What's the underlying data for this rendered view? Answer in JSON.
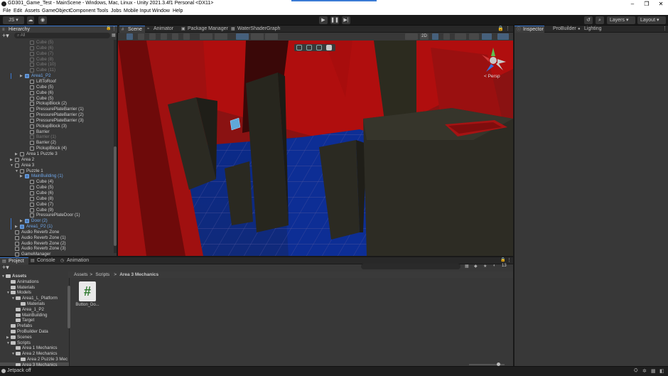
{
  "window": {
    "title": "GD301_Game_Test - MainScene - Windows, Mac, Linux - Unity 2021.3.4f1 Personal <DX11>",
    "controls": [
      "–",
      "❐",
      "✕"
    ]
  },
  "menu": [
    "File",
    "Edit",
    "Assets",
    "GameObject",
    "Component",
    "Tools",
    "Jobs",
    "Mobile Input",
    "Window",
    "Help"
  ],
  "toolbar": {
    "account": "JS ▾",
    "layers": "Layers",
    "layout": "Layout"
  },
  "hierarchy": {
    "tab": "Hierarchy",
    "search_placeholder": "All",
    "rows": [
      {
        "label": "Cube (5)",
        "depth": 6,
        "style": "dim"
      },
      {
        "label": "Cube (6)",
        "depth": 6,
        "style": "dim"
      },
      {
        "label": "Cube (7)",
        "depth": 6,
        "style": "dim"
      },
      {
        "label": "Cube (8)",
        "depth": 6,
        "style": "dim"
      },
      {
        "label": "Cube (10)",
        "depth": 6,
        "style": "dim"
      },
      {
        "label": "Cube (11)",
        "depth": 6,
        "style": "dim"
      },
      {
        "label": "Area1_P2",
        "depth": 5,
        "style": "prefab",
        "arrow": "▶",
        "marker": true
      },
      {
        "label": "LiftToRoof",
        "depth": 6,
        "style": "normal"
      },
      {
        "label": "Cube (5)",
        "depth": 6,
        "style": "normal"
      },
      {
        "label": "Cube (6)",
        "depth": 6,
        "style": "normal"
      },
      {
        "label": "Cube (5)",
        "depth": 6,
        "style": "normal"
      },
      {
        "label": "PickupBlock (2)",
        "depth": 6,
        "style": "normal"
      },
      {
        "label": "PressurePlateBarrier (1)",
        "depth": 6,
        "style": "normal"
      },
      {
        "label": "PressurePlateBarrier (2)",
        "depth": 6,
        "style": "normal"
      },
      {
        "label": "PressurePlateBarrier (3)",
        "depth": 6,
        "style": "normal"
      },
      {
        "label": "PickupBlock (3)",
        "depth": 6,
        "style": "normal"
      },
      {
        "label": "Barrier",
        "depth": 6,
        "style": "normal"
      },
      {
        "label": "Barrier (1)",
        "depth": 6,
        "style": "dim"
      },
      {
        "label": "Barrier (2)",
        "depth": 6,
        "style": "normal"
      },
      {
        "label": "PickupBlock (4)",
        "depth": 6,
        "style": "normal"
      },
      {
        "label": "Area 1 Puzzle 3",
        "depth": 4,
        "style": "normal",
        "arrow": "▶"
      },
      {
        "label": "Area 2",
        "depth": 3,
        "style": "normal",
        "arrow": "▶"
      },
      {
        "label": "Area 3",
        "depth": 3,
        "style": "normal",
        "arrow": "▼"
      },
      {
        "label": "Puzzle 1",
        "depth": 4,
        "style": "normal",
        "arrow": "▼"
      },
      {
        "label": "MainBuilding (1)",
        "depth": 5,
        "style": "prefab",
        "arrow": "▶"
      },
      {
        "label": "Cube (4)",
        "depth": 6,
        "style": "normal"
      },
      {
        "label": "Cube (5)",
        "depth": 6,
        "style": "normal"
      },
      {
        "label": "Cube (6)",
        "depth": 6,
        "style": "normal"
      },
      {
        "label": "Cube (8)",
        "depth": 6,
        "style": "normal"
      },
      {
        "label": "Cube (7)",
        "depth": 6,
        "style": "normal"
      },
      {
        "label": "Cube (9)",
        "depth": 6,
        "style": "normal"
      },
      {
        "label": "PressurePlateDoor (1)",
        "depth": 6,
        "style": "normal"
      },
      {
        "label": "Door (2)",
        "depth": 5,
        "style": "prefab",
        "arrow": "▶",
        "marker": true
      },
      {
        "label": "Area1_P2 (1)",
        "depth": 4,
        "style": "prefab",
        "arrow": "▶",
        "marker": true
      },
      {
        "label": "Audio Reverb Zone",
        "depth": 3,
        "style": "normal"
      },
      {
        "label": "Audio Reverb Zone (1)",
        "depth": 3,
        "style": "normal"
      },
      {
        "label": "Audio Reverb Zone (2)",
        "depth": 3,
        "style": "normal"
      },
      {
        "label": "Audio Reverb Zone (3)",
        "depth": 3,
        "style": "normal"
      },
      {
        "label": "GameManager",
        "depth": 3,
        "style": "normal"
      }
    ]
  },
  "scene": {
    "tabs": [
      {
        "label": "Scene",
        "active": true,
        "icon": "#"
      },
      {
        "label": "Animator",
        "active": false,
        "icon": "≈"
      },
      {
        "label": "Package Manager",
        "active": false,
        "icon": "▣"
      },
      {
        "label": "WaterShaderGraph",
        "active": false,
        "icon": "▦"
      }
    ],
    "mode_2d": "2D",
    "persp_label": "< Persp"
  },
  "inspector": {
    "tabs": [
      {
        "label": "Inspector",
        "active": true,
        "icon": "ⓘ"
      },
      {
        "label": "ProBuilder",
        "active": false,
        "icon": ""
      },
      {
        "label": "Lighting",
        "active": false,
        "icon": "●"
      }
    ]
  },
  "project": {
    "tabs": [
      {
        "label": "Project",
        "active": true,
        "icon": "▤"
      },
      {
        "label": "Console",
        "active": false,
        "icon": "▤"
      },
      {
        "label": "Animation",
        "active": false,
        "icon": "◷"
      }
    ],
    "tree": [
      {
        "label": "Assets",
        "depth": 0,
        "arrow": "▼",
        "bold": true
      },
      {
        "label": "Animations",
        "depth": 1,
        "arrow": ""
      },
      {
        "label": "Materials",
        "depth": 1,
        "arrow": ""
      },
      {
        "label": "Models",
        "depth": 1,
        "arrow": "▼"
      },
      {
        "label": "Area1_L_Platform",
        "depth": 2,
        "arrow": "▼"
      },
      {
        "label": "Materials",
        "depth": 3,
        "arrow": ""
      },
      {
        "label": "Area_1_P2",
        "depth": 2,
        "arrow": ""
      },
      {
        "label": "MainBuilding",
        "depth": 2,
        "arrow": ""
      },
      {
        "label": "Target",
        "depth": 2,
        "arrow": ""
      },
      {
        "label": "Prefabs",
        "depth": 1,
        "arrow": ""
      },
      {
        "label": "ProBuilder Data",
        "depth": 1,
        "arrow": ""
      },
      {
        "label": "Scenes",
        "depth": 1,
        "arrow": "▶"
      },
      {
        "label": "Scripts",
        "depth": 1,
        "arrow": "▼"
      },
      {
        "label": "Area 1 Mechanics",
        "depth": 2,
        "arrow": ""
      },
      {
        "label": "Area 2 Mechanics",
        "depth": 2,
        "arrow": "▼"
      },
      {
        "label": "Area 2 Puzzle 3 Mec",
        "depth": 3,
        "arrow": ""
      },
      {
        "label": "Area 3 Mechanics",
        "depth": 2,
        "arrow": "",
        "selected": true
      }
    ],
    "breadcrumb": [
      "Assets",
      "Scripts",
      "Area 3 Mechanics"
    ],
    "hidden_count": "13",
    "assets": [
      {
        "name": "Button_Do...",
        "glyph": "#"
      }
    ]
  },
  "status": {
    "message": "Jetpack off"
  }
}
